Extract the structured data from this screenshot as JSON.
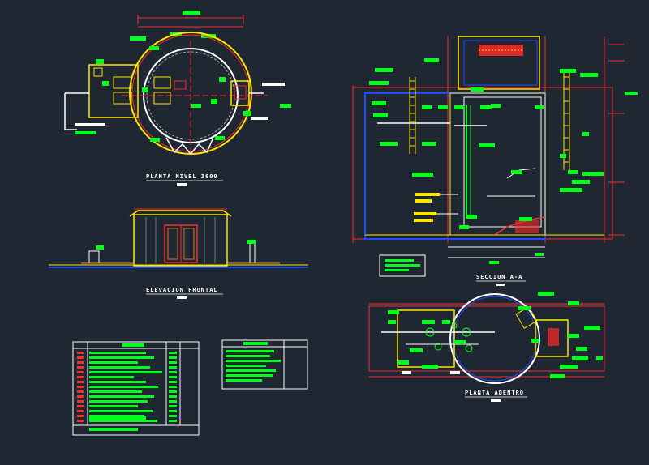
{
  "drawing": {
    "background": "#1f2733",
    "colors": {
      "red": "#ff2a2a",
      "yellow": "#ffe600",
      "blue": "#1a4cff",
      "green": "#00ff1a",
      "white": "#ffffff",
      "orange": "#ff8a1a",
      "magenta": "#ff33cc",
      "gray": "#b0b0b0"
    },
    "titles": {
      "planta_nivel": "PLANTA NIVEL 3600",
      "elevacion": "ELEVACION FRONTAL",
      "seccion": "SECCION A-A",
      "planta_adentro": "PLANTA ADENTRO"
    }
  }
}
